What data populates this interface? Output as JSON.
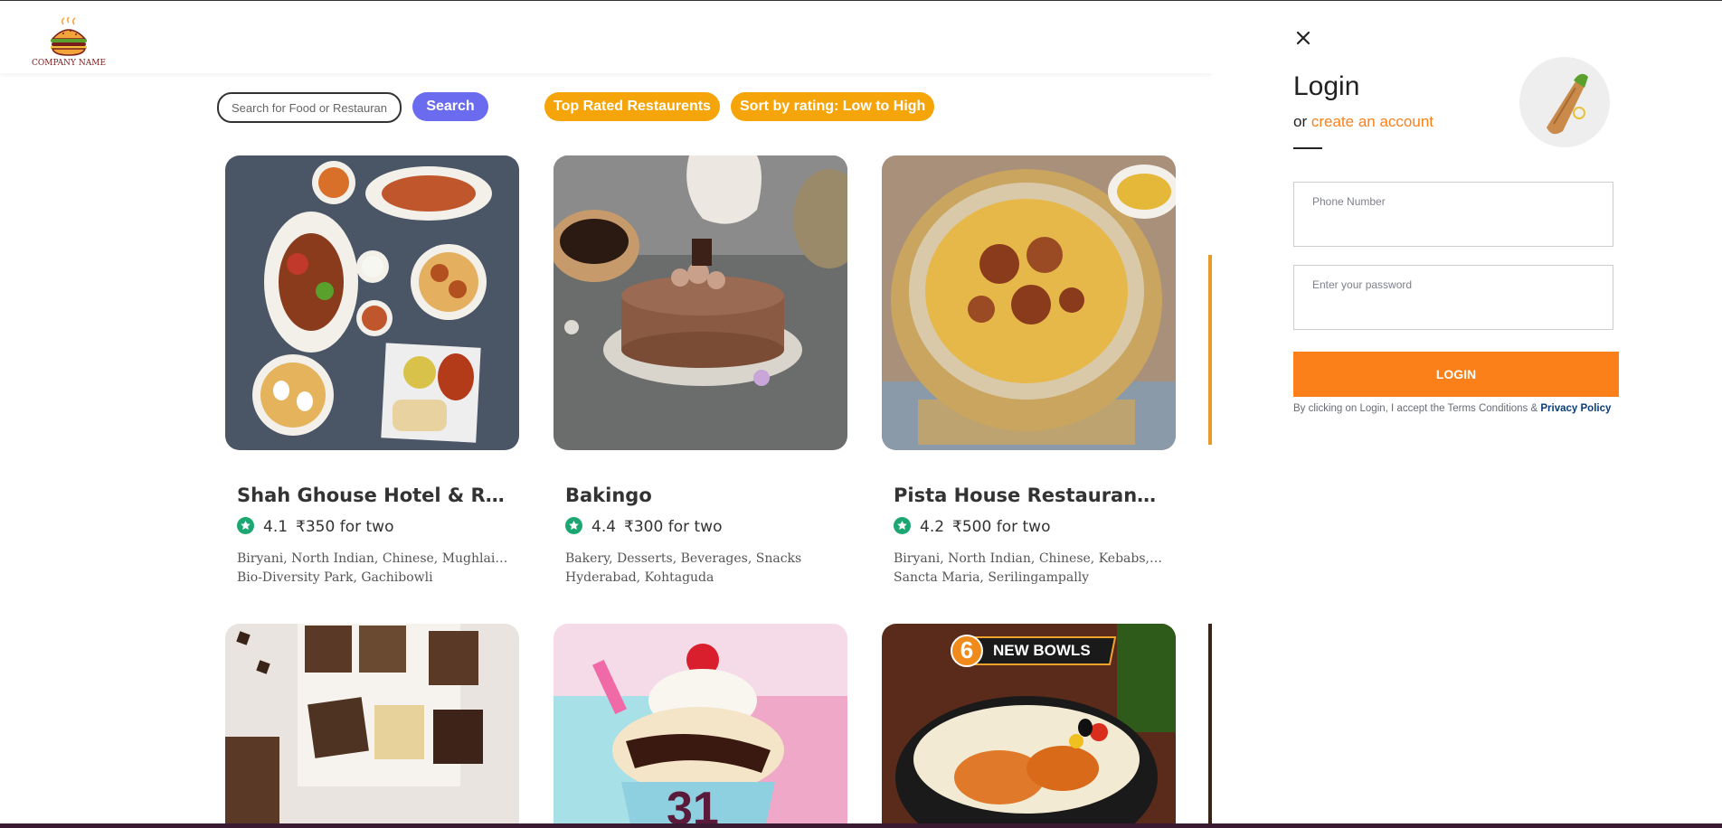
{
  "header": {
    "company_name": "COMPANY NAME"
  },
  "search": {
    "placeholder": "Search for Food or Restaurants",
    "button_label": "Search"
  },
  "filters": {
    "top_rated_label": "Top Rated Restaurents",
    "sort_label": "Sort by rating: Low to High"
  },
  "restaurants": [
    {
      "name": "Shah Ghouse Hotel & Restaurant",
      "rating": "4.1",
      "cost": "₹350 for two",
      "cuisines": "Biryani, North Indian, Chinese, Mughlai, Kebabs",
      "location": "Bio-Diversity Park, Gachibowli"
    },
    {
      "name": "Bakingo",
      "rating": "4.4",
      "cost": "₹300 for two",
      "cuisines": "Bakery, Desserts, Beverages, Snacks",
      "location": "Hyderabad, Kohtaguda"
    },
    {
      "name": "Pista House Restaurant & Bakery",
      "rating": "4.2",
      "cost": "₹500 for two",
      "cuisines": "Biryani, North Indian, Chinese, Kebabs, Desserts",
      "location": "Sancta Maria, Serilingampally"
    }
  ],
  "promo": {
    "number": "6",
    "text": "NEW BOWLS"
  },
  "login": {
    "title": "Login",
    "or_text": "or",
    "create_account": "create an account",
    "phone_placeholder": "Phone Number",
    "password_placeholder": "Enter your password",
    "button_label": "LOGIN",
    "terms_text": "By clicking on Login, I accept the Terms Conditions & ",
    "privacy_text": "Privacy Policy"
  },
  "colors": {
    "accent_orange": "#fc8019",
    "filter_yellow": "#f5a40a",
    "search_purple": "#6b6bf0",
    "rating_green": "#1ba672"
  }
}
